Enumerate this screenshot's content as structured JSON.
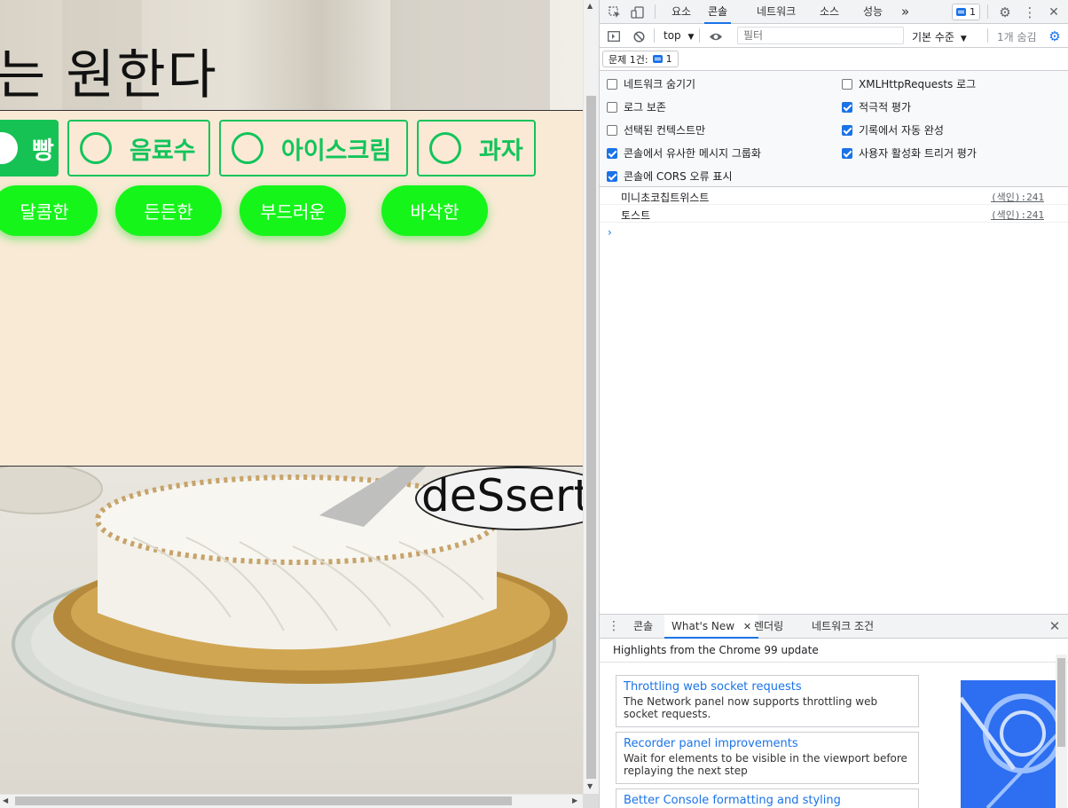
{
  "page": {
    "hero_title": "는 원한다",
    "categories": [
      {
        "label": "빵",
        "active": true
      },
      {
        "label": "음료수",
        "active": false
      },
      {
        "label": "아이스크림",
        "active": false
      },
      {
        "label": "과자",
        "active": false
      }
    ],
    "tags": [
      "달콤한",
      "든든한",
      "부드러운",
      "바삭한"
    ],
    "bubble_text": "deSsert",
    "colors": {
      "accent_green": "#12c45a",
      "tag_green": "#16f51a",
      "background": "#f9ead6"
    }
  },
  "devtools": {
    "main_tabs": [
      "요소",
      "콘솔",
      "네트워크",
      "소스",
      "성능"
    ],
    "active_main_tab": "콘솔",
    "more_tabs_symbol": "»",
    "issues_badge_count": "1",
    "context_selector": "top",
    "filter_placeholder": "필터",
    "log_level": "기본 수준",
    "hidden_count": "1개 숨김",
    "issues_summary_label": "문제 1건:",
    "issues_summary_count": "1",
    "settings_left": [
      {
        "label": "네트워크 숨기기",
        "checked": false
      },
      {
        "label": "로그 보존",
        "checked": false
      },
      {
        "label": "선택된 컨텍스트만",
        "checked": false
      },
      {
        "label": "콘솔에서 유사한 메시지 그룹화",
        "checked": true
      },
      {
        "label": "콘솔에 CORS 오류 표시",
        "checked": true
      }
    ],
    "settings_right": [
      {
        "label": "XMLHttpRequests 로그",
        "checked": false
      },
      {
        "label": "적극적 평가",
        "checked": true
      },
      {
        "label": "기록에서 자동 완성",
        "checked": true
      },
      {
        "label": "사용자 활성화 트리거 평가",
        "checked": true
      }
    ],
    "console_logs": [
      {
        "message": "미니초코칩트위스트",
        "source": "(색인):241"
      },
      {
        "message": "토스트",
        "source": "(색인):241"
      }
    ],
    "prompt_symbol": "›",
    "drawer_tabs": [
      "콘솔",
      "What's New",
      "렌더링",
      "네트워크 조건"
    ],
    "active_drawer_tab": "What's New",
    "whats_new": {
      "header": "Highlights from the Chrome 99 update",
      "cards": [
        {
          "title": "Throttling web socket requests",
          "desc": "The Network panel now supports throttling web socket requests."
        },
        {
          "title": "Recorder panel improvements",
          "desc": "Wait for elements to be visible in the viewport before replaying the next step"
        },
        {
          "title": "Better Console formatting and styling",
          "desc": ""
        }
      ]
    },
    "colors": {
      "blue": "#1a73e8",
      "panel_bg": "#f1f3f4"
    }
  }
}
